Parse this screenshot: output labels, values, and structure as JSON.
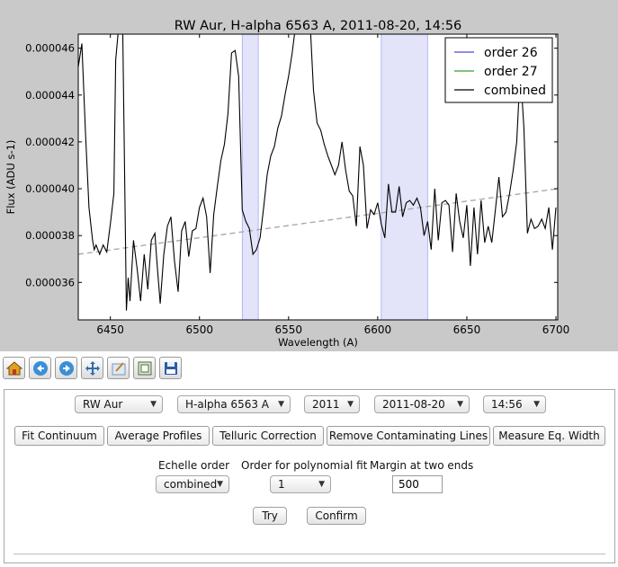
{
  "chart_data": {
    "type": "line",
    "title": "RW Aur, H-alpha 6563 A, 2011-08-20, 14:56",
    "xlabel": "Wavelength (A)",
    "ylabel": "Flux (ADU s-1)",
    "xlim": [
      6432,
      6701
    ],
    "ylim": [
      3.44e-05,
      4.66e-05
    ],
    "xticks": [
      6450,
      6500,
      6550,
      6600,
      6650,
      6700
    ],
    "xtick_labels": [
      "6450",
      "6500",
      "6550",
      "6600",
      "6650",
      "6700"
    ],
    "yticks": [
      3.6e-05,
      3.8e-05,
      4e-05,
      4.2e-05,
      4.4e-05,
      4.6e-05
    ],
    "ytick_labels": [
      "0.000036",
      "0.000038",
      "0.000040",
      "0.000042",
      "0.000044",
      "0.000046"
    ],
    "legend_position": "top-right",
    "series": [
      {
        "name": "order 26",
        "color": "#4b4bd6",
        "values": []
      },
      {
        "name": "order 27",
        "color": "#2ea02e",
        "values": []
      },
      {
        "name": "combined",
        "color": "#000000",
        "x": [
          6432,
          6434,
          6436,
          6438,
          6440,
          6441,
          6442,
          6444,
          6446,
          6448,
          6450,
          6452,
          6453,
          6455,
          6457,
          6459,
          6460,
          6461,
          6463,
          6465,
          6467,
          6469,
          6471,
          6473,
          6475,
          6476,
          6478,
          6480,
          6482,
          6484,
          6486,
          6488,
          6490,
          6492,
          6494,
          6496,
          6498,
          6500,
          6502,
          6504,
          6506,
          6508,
          6510,
          6512,
          6514,
          6516,
          6518,
          6520,
          6522,
          6524,
          6526,
          6528,
          6530,
          6532,
          6534,
          6536,
          6538,
          6540,
          6542,
          6544,
          6546,
          6548,
          6550,
          6552,
          6554,
          6556,
          6558,
          6560,
          6562,
          6564,
          6566,
          6568,
          6570,
          6572,
          6574,
          6576,
          6578,
          6580,
          6582,
          6584,
          6586,
          6588,
          6590,
          6592,
          6594,
          6596,
          6598,
          6600,
          6602,
          6604,
          6606,
          6608,
          6610,
          6612,
          6614,
          6616,
          6618,
          6620,
          6622,
          6624,
          6626,
          6628,
          6630,
          6632,
          6634,
          6636,
          6638,
          6640,
          6642,
          6644,
          6646,
          6648,
          6650,
          6652,
          6654,
          6656,
          6658,
          6660,
          6662,
          6664,
          6666,
          6668,
          6670,
          6672,
          6674,
          6676,
          6678,
          6680,
          6682,
          6684,
          6686,
          6688,
          6690,
          6692,
          6694,
          6696,
          6698,
          6700
        ],
        "values": [
          4.52e-05,
          4.62e-05,
          4.25e-05,
          3.92e-05,
          3.78e-05,
          3.74e-05,
          3.76e-05,
          3.72e-05,
          3.76e-05,
          3.73e-05,
          3.85e-05,
          3.98e-05,
          4.55e-05,
          4.72e-05,
          4.66e-05,
          3.48e-05,
          3.62e-05,
          3.52e-05,
          3.78e-05,
          3.66e-05,
          3.52e-05,
          3.72e-05,
          3.57e-05,
          3.78e-05,
          3.81e-05,
          3.7e-05,
          3.51e-05,
          3.72e-05,
          3.84e-05,
          3.88e-05,
          3.69e-05,
          3.56e-05,
          3.82e-05,
          3.86e-05,
          3.71e-05,
          3.82e-05,
          3.83e-05,
          3.92e-05,
          3.96e-05,
          3.88e-05,
          3.64e-05,
          3.89e-05,
          4.01e-05,
          4.12e-05,
          4.19e-05,
          4.32e-05,
          4.58e-05,
          4.59e-05,
          4.48e-05,
          3.91e-05,
          3.86e-05,
          3.83e-05,
          3.72e-05,
          3.74e-05,
          3.79e-05,
          3.92e-05,
          4.06e-05,
          4.14e-05,
          4.18e-05,
          4.26e-05,
          4.31e-05,
          4.4e-05,
          4.48e-05,
          4.58e-05,
          4.7e-05,
          4.68e-05,
          4.76e-05,
          4.75e-05,
          4.72e-05,
          4.42e-05,
          4.28e-05,
          4.25e-05,
          4.19e-05,
          4.14e-05,
          4.1e-05,
          4.06e-05,
          4.1e-05,
          4.2e-05,
          4.08e-05,
          3.99e-05,
          3.97e-05,
          3.84e-05,
          4.18e-05,
          4.1e-05,
          3.83e-05,
          3.91e-05,
          3.89e-05,
          3.94e-05,
          3.85e-05,
          3.79e-05,
          4.02e-05,
          3.9e-05,
          3.9e-05,
          4.01e-05,
          3.88e-05,
          3.94e-05,
          3.95e-05,
          3.93e-05,
          3.96e-05,
          3.92e-05,
          3.8e-05,
          3.86e-05,
          3.74e-05,
          4e-05,
          3.78e-05,
          3.94e-05,
          3.95e-05,
          3.93e-05,
          3.73e-05,
          3.98e-05,
          3.86e-05,
          3.79e-05,
          3.93e-05,
          3.67e-05,
          3.92e-05,
          3.72e-05,
          3.95e-05,
          3.77e-05,
          3.84e-05,
          3.77e-05,
          3.91e-05,
          4.05e-05,
          3.88e-05,
          3.9e-05,
          3.98e-05,
          4.08e-05,
          4.2e-05,
          4.51e-05,
          4.26e-05,
          3.81e-05,
          3.87e-05,
          3.83e-05,
          3.84e-05,
          3.87e-05,
          3.83e-05,
          3.92e-05,
          3.74e-05,
          3.92e-05
        ]
      }
    ],
    "continuum_line": {
      "style": "dashed",
      "color": "#aaaaaa",
      "x": [
        6432,
        6701
      ],
      "y": [
        3.72e-05,
        4e-05
      ]
    },
    "shaded_bands": [
      {
        "x": [
          6524,
          6533
        ],
        "color": "#e3e3fa"
      },
      {
        "x": [
          6602,
          6628
        ],
        "color": "#e3e3fa"
      }
    ],
    "grid": false
  },
  "toolbar": {
    "icons": [
      "home-icon",
      "back-arrow-icon",
      "forward-arrow-icon",
      "pan-icon",
      "zoom-icon",
      "subplots-icon",
      "save-icon"
    ]
  },
  "controls": {
    "star": "RW Aur",
    "line": "H-alpha 6563 A",
    "year": "2011",
    "date": "2011-08-20",
    "time": "14:56"
  },
  "tabs": [
    "Fit Continuum",
    "Average Profiles",
    "Telluric Correction",
    "Remove Contaminating Lines",
    "Measure Eq. Width"
  ],
  "form": {
    "echelle_label": "Echelle order",
    "echelle_value": "combined",
    "poly_label": "Order for polynomial fit",
    "poly_value": "1",
    "margin_label": "Margin at two ends",
    "margin_value": "500",
    "try_label": "Try",
    "confirm_label": "Confirm"
  }
}
